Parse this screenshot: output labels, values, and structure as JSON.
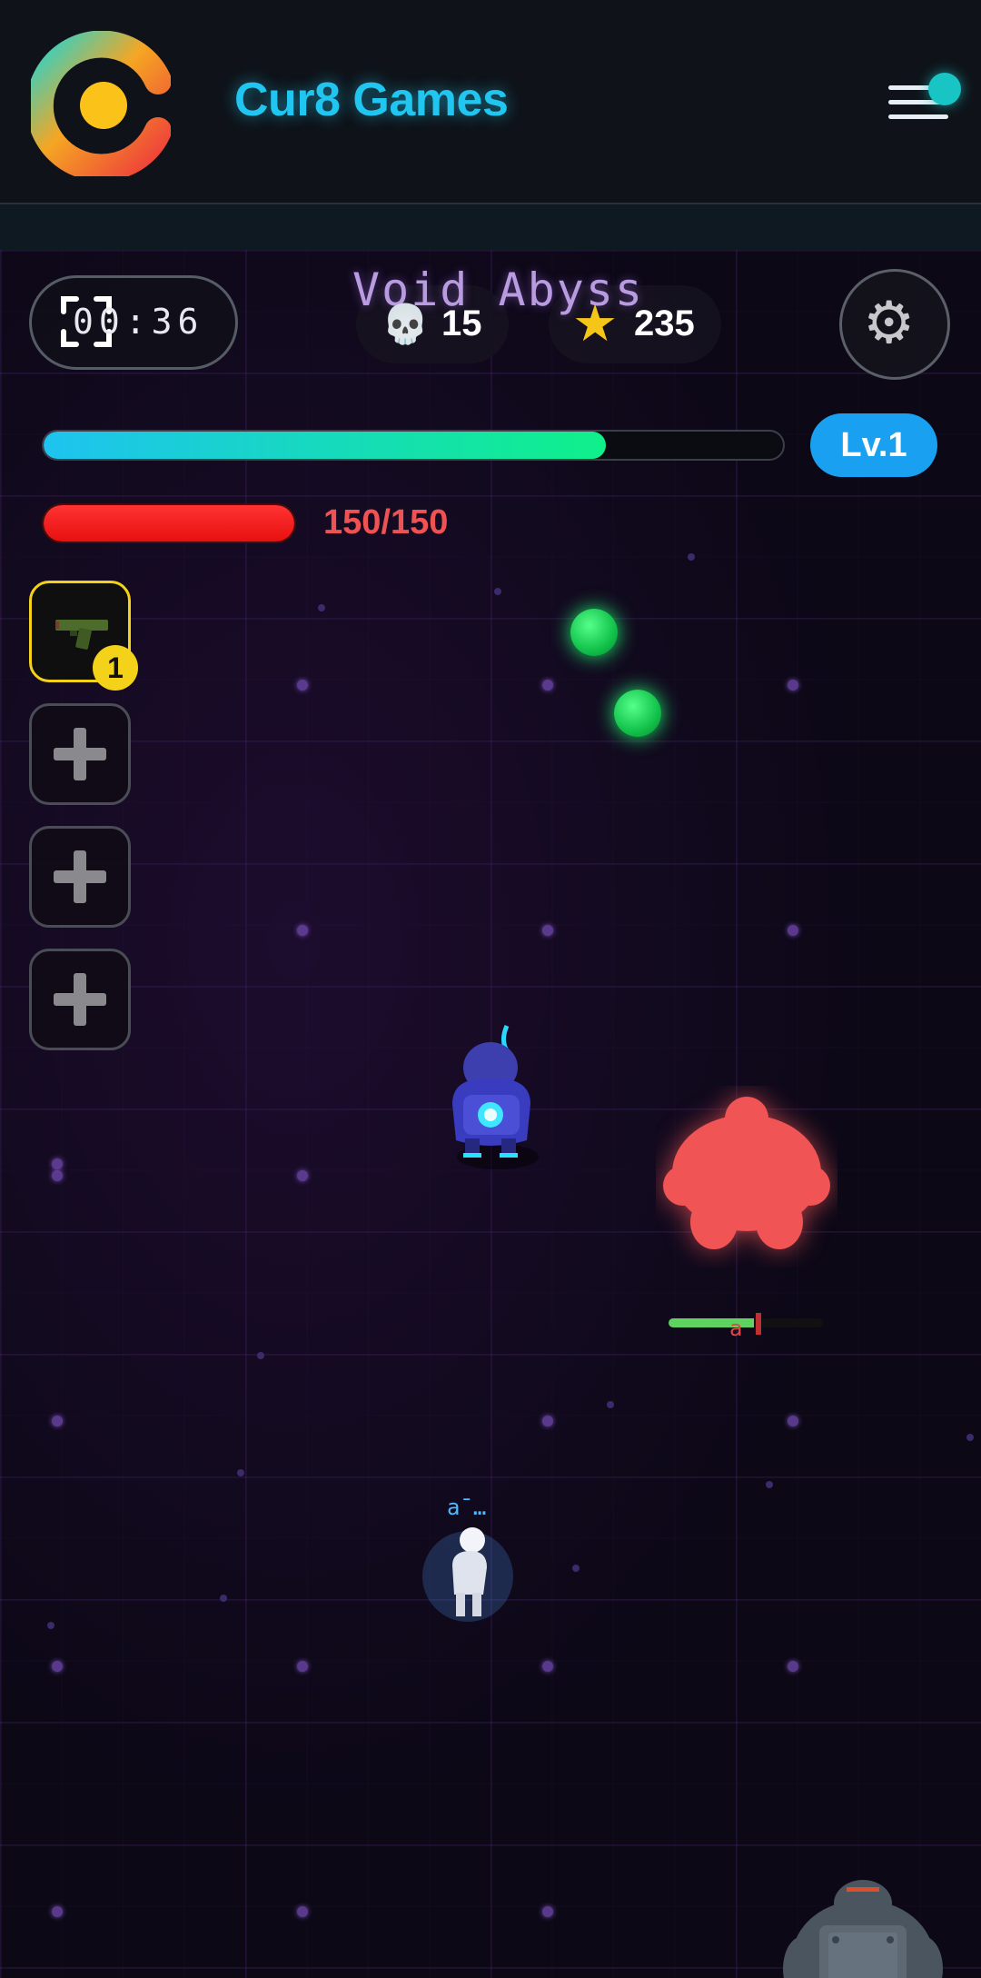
{
  "header": {
    "brand": "Cur8 Games",
    "menu_icon": "hamburger-menu-icon",
    "notification_color": "#18c4c4",
    "brand_color": "#21c6f0"
  },
  "hud": {
    "timer": "00:36",
    "zone_name": "Void Abyss",
    "kills": "15",
    "coins": "235",
    "level": "Lv.1",
    "xp_fraction": 0.76,
    "hp_text": "150/150",
    "hp_fraction": 1.0,
    "skull_glyph": "💀",
    "star_glyph": "★",
    "gear_glyph": "⚙"
  },
  "weapons": {
    "slots": [
      {
        "item": "pistol",
        "level": "1",
        "icon": "pistol-icon"
      },
      {
        "item": "empty",
        "icon": "plus-icon"
      },
      {
        "item": "empty",
        "icon": "plus-icon"
      },
      {
        "item": "empty",
        "icon": "plus-icon"
      }
    ]
  },
  "entities": {
    "enemy_hp_fraction": 0.55,
    "colors": {
      "enemy_red": "#f05454",
      "orb_green": "#1ef070",
      "player_blue": "#3a3fc0"
    }
  }
}
